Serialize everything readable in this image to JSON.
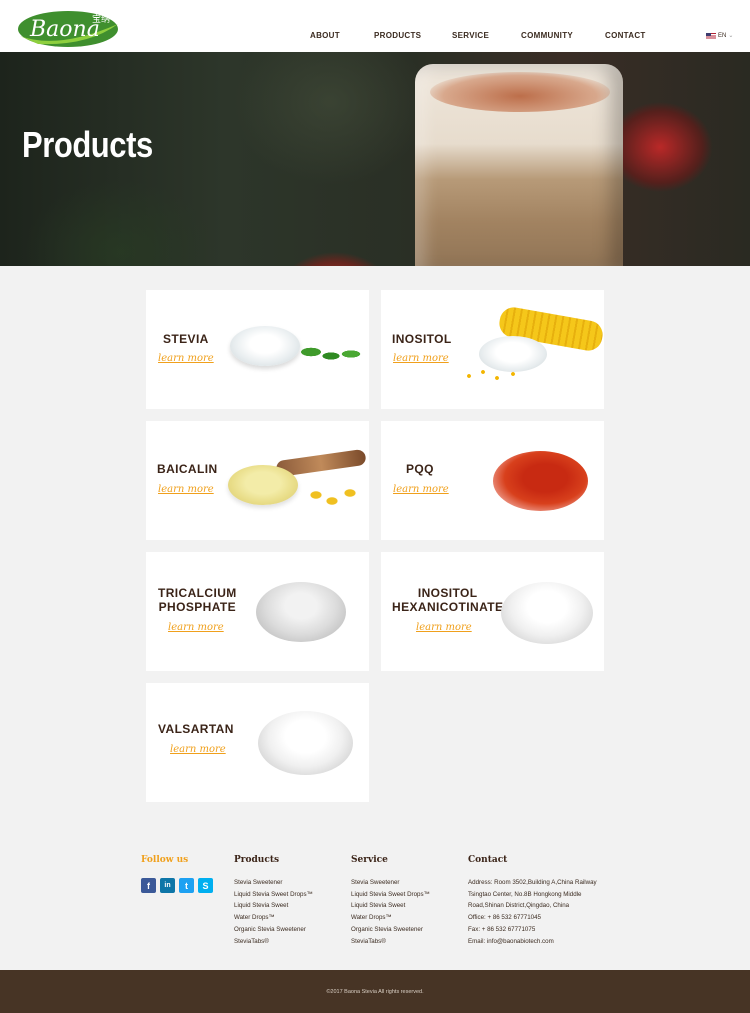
{
  "header": {
    "logo_text": "Baona",
    "logo_cn": "宝纳",
    "nav": [
      "ABOUT",
      "PRODUCTS",
      "SERVICE",
      "COMMUNITY",
      "CONTACT"
    ],
    "lang": "EN"
  },
  "hero": {
    "title": "Products"
  },
  "products": [
    {
      "name": "STEVIA",
      "link": "learn more"
    },
    {
      "name": "INOSITOL",
      "link": "learn more"
    },
    {
      "name": "BAICALIN",
      "link": "learn more"
    },
    {
      "name": "PQQ",
      "link": "learn more"
    },
    {
      "name": "TRICALCIUM\nPHOSPHATE",
      "link": "learn more"
    },
    {
      "name": "INOSITOL\nHEXANICOTINATE",
      "link": "learn more"
    },
    {
      "name": "VALSARTAN",
      "link": "learn more"
    }
  ],
  "footer": {
    "follow_title": "Follow us",
    "products_title": "Products",
    "products_items": [
      "Stevia Sweetener",
      "Liquid Stevia Sweet Drops™",
      "Liquid Stevia Sweet",
      "Water Drops™",
      "Organic Stevia Sweetener",
      "SteviaTabs®"
    ],
    "service_title": "Service",
    "service_items": [
      "Stevia Sweetener",
      "Liquid Stevia Sweet Drops™",
      "Liquid Stevia Sweet",
      "Water Drops™",
      "Organic Stevia Sweetener",
      "SteviaTabs®"
    ],
    "contact_title": "Contact",
    "contact_items": [
      "Address: Room 3502,Building A,China Railway",
      "Tsingtao Center, No.8B Hongkong Middle",
      "Road,Shinan District,Qingdao, China",
      "Office: + 86 532 67771045",
      "Fax: + 86 532 67771075",
      "Email: info@baonabiotech.com"
    ],
    "social_icons": [
      "facebook-icon",
      "linkedin-icon",
      "twitter-icon",
      "skype-icon"
    ],
    "copyright": "©2017 Baona Stevia All rights reserved."
  },
  "colors": {
    "accent": "#f0a01c",
    "brown": "#3b2418",
    "footer_bar": "#473425",
    "logo_green": "#3f8f2e"
  }
}
